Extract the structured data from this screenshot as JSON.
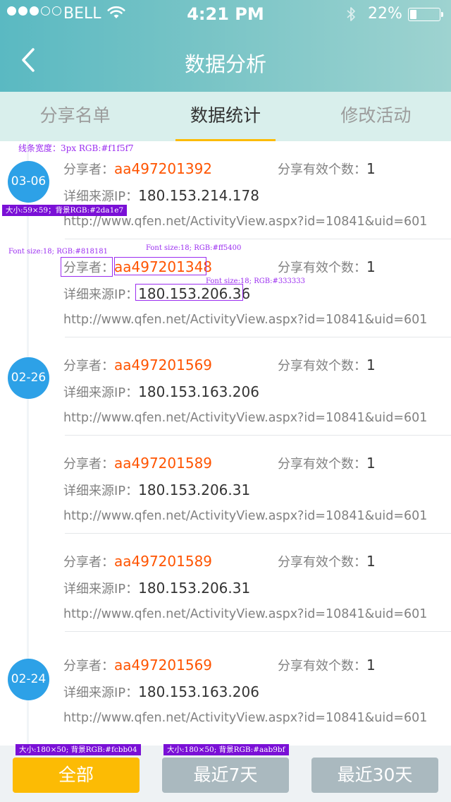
{
  "status_bar": {
    "carrier": "BELL",
    "time": "4:21 PM",
    "battery_percent": "22%",
    "battery_level": 0.22,
    "signal_bars_filled": 3,
    "signal_bars_total": 5
  },
  "nav": {
    "title": "数据分析",
    "back_icon": "chevron-left-icon"
  },
  "tabs": [
    {
      "label": "分享名单",
      "active": false
    },
    {
      "label": "数据统计",
      "active": true
    },
    {
      "label": "修改活动",
      "active": false
    }
  ],
  "labels": {
    "sharer": "分享者：",
    "valid_count": "分享有效个数：",
    "source_ip": "详细来源IP："
  },
  "records": [
    {
      "date": "03-06",
      "sharer": "aa497201392",
      "count": "1",
      "ip": "180.153.214.178",
      "url": "http://www.qfen.net/ActivityView.aspx?id=10841&uid=601"
    },
    {
      "date": "",
      "sharer": "aa497201348",
      "count": "1",
      "ip": "180.153.206.36",
      "url": "http://www.qfen.net/ActivityView.aspx?id=10841&uid=601"
    },
    {
      "date": "02-26",
      "sharer": "aa497201569",
      "count": "1",
      "ip": "180.153.163.206",
      "url": "http://www.qfen.net/ActivityView.aspx?id=10841&uid=601"
    },
    {
      "date": "",
      "sharer": "aa497201589",
      "count": "1",
      "ip": "180.153.206.31",
      "url": "http://www.qfen.net/ActivityView.aspx?id=10841&uid=601"
    },
    {
      "date": "",
      "sharer": "aa497201589",
      "count": "1",
      "ip": "180.153.206.31",
      "url": "http://www.qfen.net/ActivityView.aspx?id=10841&uid=601"
    },
    {
      "date": "02-24",
      "sharer": "aa497201569",
      "count": "1",
      "ip": "180.153.163.206",
      "url": "http://www.qfen.net/ActivityView.aspx?id=10841&uid=601"
    }
  ],
  "filters": [
    {
      "label": "全部",
      "active": true
    },
    {
      "label": "最近7天",
      "active": false
    },
    {
      "label": "最近30天",
      "active": false
    }
  ],
  "annotations": {
    "timeline_line": "线条宽度：3px  RGB:#f1f5f7",
    "date_badge": "大小:59×59；背景RGB:#2da1e7",
    "label_font": "Font size:18; RGB:#818181",
    "sharer_font": "Font size:18; RGB:#ff5400",
    "ip_font": "Font size:18; RGB:#333333",
    "active_filter": "大小:180×50; 背景RGB:#fcbb04",
    "inactive_filter": "大小:180×50; 背景RGB:#aab9bf"
  },
  "colors": {
    "header_gradient_start": "#5ab9c2",
    "header_gradient_end": "#9ed3d0",
    "tab_bar": "#d9efec",
    "tab_indicator": "#fcbb04",
    "date_badge": "#2da1e7",
    "sharer_text": "#ff5400",
    "label_text": "#818181",
    "value_text": "#333333",
    "timeline": "#f1f5f7",
    "filter_active": "#fcbb04",
    "filter_inactive": "#aab9bf"
  }
}
